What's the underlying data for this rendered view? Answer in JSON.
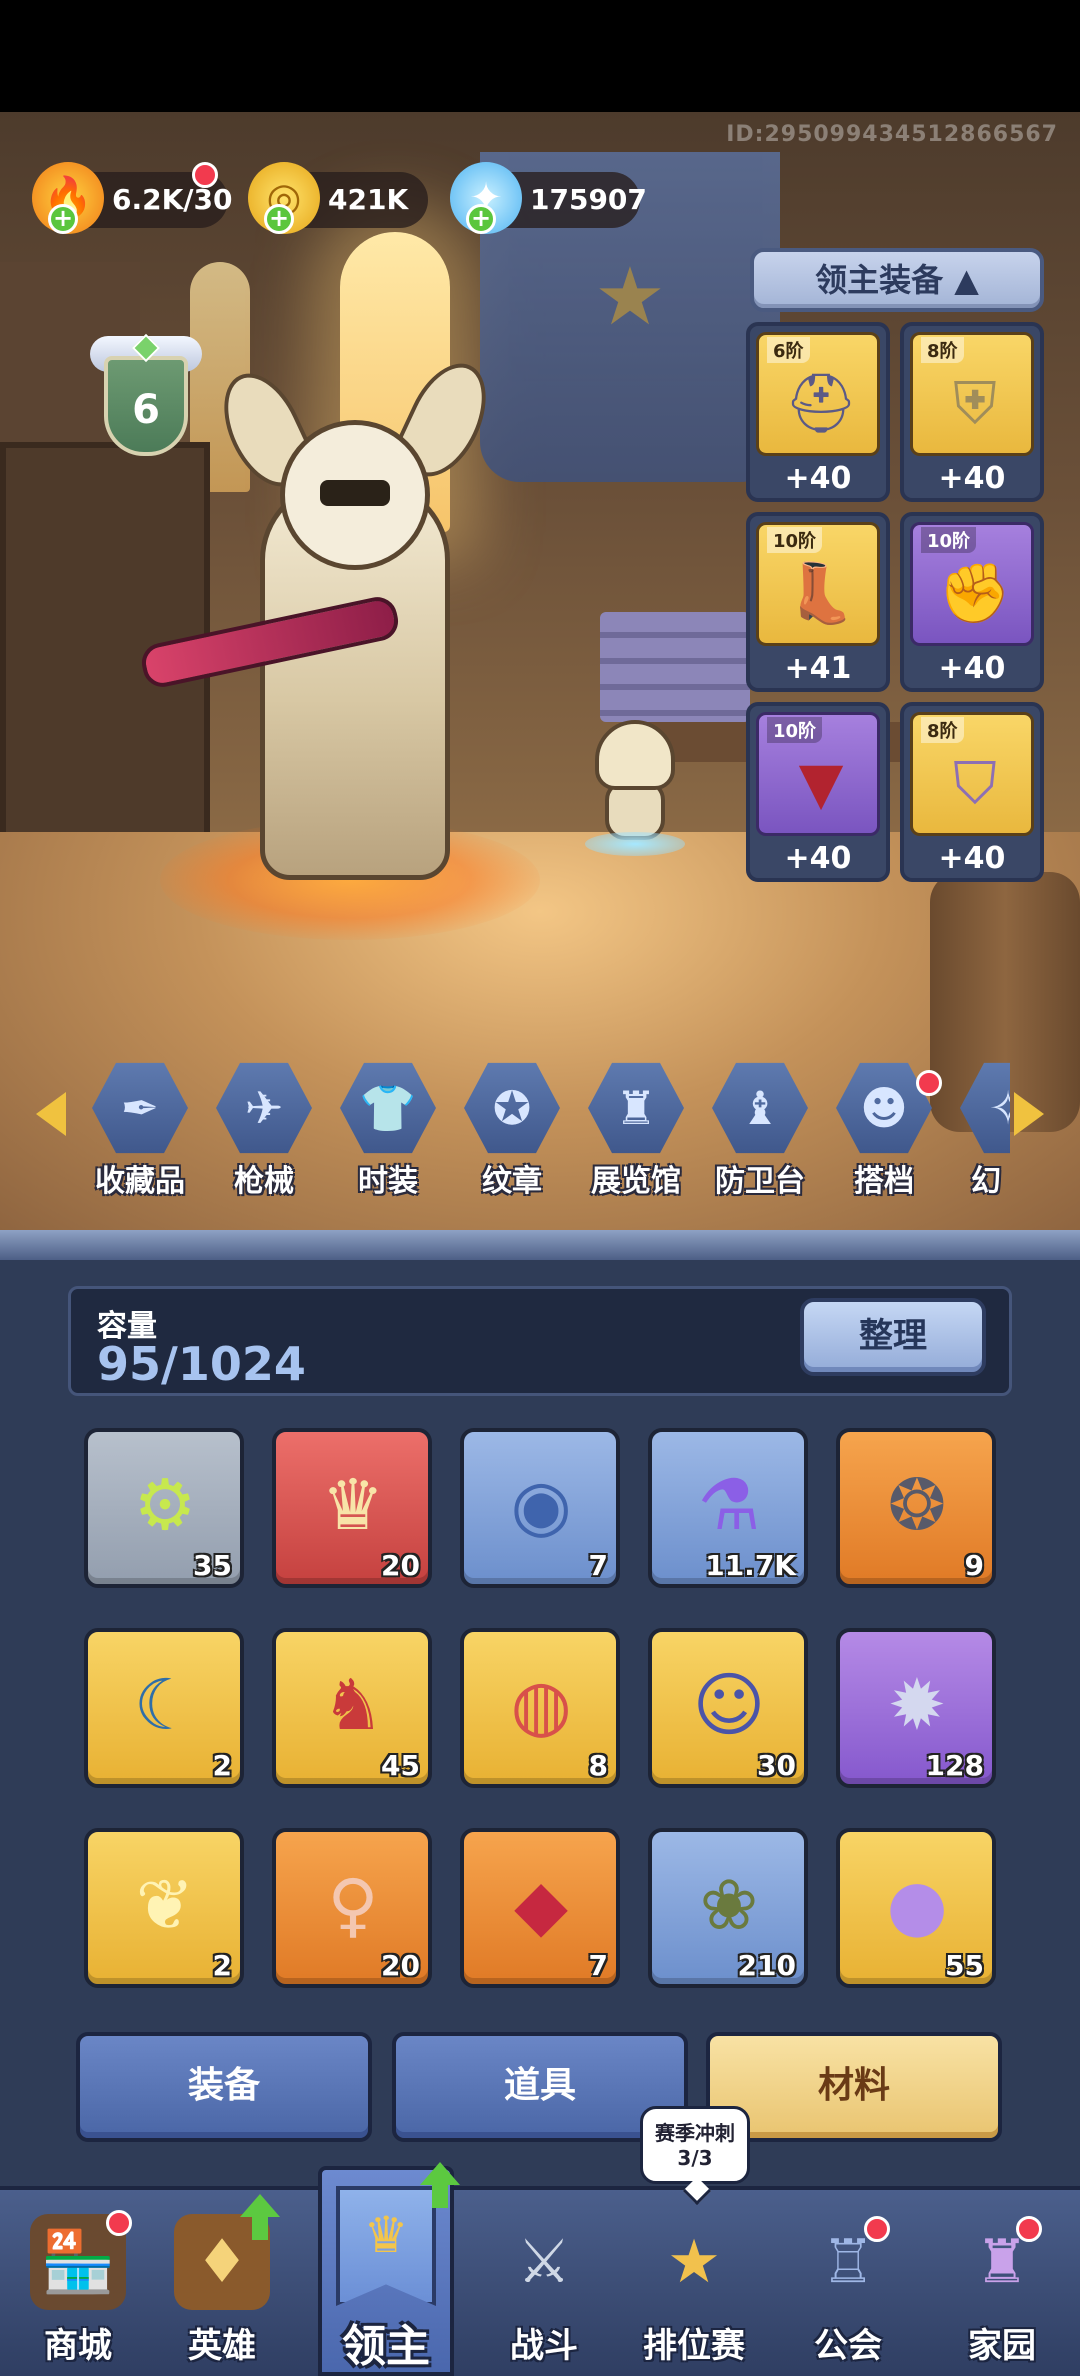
{
  "header": {
    "player_id": "ID:295099434512866567"
  },
  "resources": [
    {
      "name": "stamina",
      "icon": "fire-icon",
      "value": "6.2K/30"
    },
    {
      "name": "gold",
      "icon": "coin-icon",
      "value": "421K"
    },
    {
      "name": "crystal",
      "icon": "crystal-icon",
      "value": "175907"
    }
  ],
  "level": {
    "value": "6"
  },
  "equipment": {
    "title": "领主装备 ▲",
    "slots": [
      {
        "tier": "6阶",
        "bonus": "+40",
        "icon": "helmet-icon",
        "rarity": "gold"
      },
      {
        "tier": "8阶",
        "bonus": "+40",
        "icon": "armor-icon",
        "rarity": "gold"
      },
      {
        "tier": "10阶",
        "bonus": "+41",
        "icon": "boots-icon",
        "rarity": "gold"
      },
      {
        "tier": "10阶",
        "bonus": "+40",
        "icon": "gauntlet-icon",
        "rarity": "purple"
      },
      {
        "tier": "10阶",
        "bonus": "+40",
        "icon": "cape-icon",
        "rarity": "purple"
      },
      {
        "tier": "8阶",
        "bonus": "+40",
        "icon": "leg-armor-icon",
        "rarity": "gold"
      }
    ]
  },
  "categories": [
    {
      "label": "收藏品",
      "icon": "feather-icon"
    },
    {
      "label": "枪械",
      "icon": "gun-icon"
    },
    {
      "label": "时装",
      "icon": "outfit-icon"
    },
    {
      "label": "纹章",
      "icon": "emblem-icon"
    },
    {
      "label": "展览馆",
      "icon": "museum-icon"
    },
    {
      "label": "防卫台",
      "icon": "tower-icon"
    },
    {
      "label": "搭档",
      "icon": "partner-icon"
    },
    {
      "label": "幻",
      "icon": "illusion-icon"
    }
  ],
  "bag": {
    "capacity_label": "容量",
    "capacity_value": "95/1024",
    "sort_label": "整理",
    "items": [
      {
        "count": "35",
        "rarity": "gray",
        "icon": "blueprint-icon"
      },
      {
        "count": "20",
        "rarity": "red",
        "icon": "hero-shard-icon"
      },
      {
        "count": "7",
        "rarity": "blue",
        "icon": "blue-coin-icon"
      },
      {
        "count": "11.7K",
        "rarity": "blue",
        "icon": "potion-icon"
      },
      {
        "count": "9",
        "rarity": "orange",
        "icon": "gem-bracelet-icon"
      },
      {
        "count": "2",
        "rarity": "yellow",
        "icon": "moon-scroll-icon"
      },
      {
        "count": "45",
        "rarity": "yellow",
        "icon": "knight-shard-icon"
      },
      {
        "count": "8",
        "rarity": "yellow",
        "icon": "token-icon"
      },
      {
        "count": "30",
        "rarity": "yellow",
        "icon": "jester-shard-icon"
      },
      {
        "count": "128",
        "rarity": "purple",
        "icon": "moon-emblem-icon"
      },
      {
        "count": "2",
        "rarity": "yellow",
        "icon": "golden-pouch-icon"
      },
      {
        "count": "20",
        "rarity": "orange",
        "icon": "girl-shard-icon"
      },
      {
        "count": "7",
        "rarity": "orange",
        "icon": "ruby-orb-icon"
      },
      {
        "count": "210",
        "rarity": "blue",
        "icon": "fairy-shard-icon"
      },
      {
        "count": "55",
        "rarity": "yellow",
        "icon": "pearl-shell-icon"
      }
    ],
    "tabs": [
      {
        "label": "装备",
        "active": false
      },
      {
        "label": "道具",
        "active": false
      },
      {
        "label": "材料",
        "active": true
      }
    ],
    "event_tooltip": {
      "title": "赛季冲刺",
      "progress": "3/3"
    }
  },
  "nav": [
    {
      "label": "商城",
      "icon": "shop-icon"
    },
    {
      "label": "英雄",
      "icon": "hero-card-icon"
    },
    {
      "label": "领主",
      "icon": "lord-banner-icon",
      "active": true
    },
    {
      "label": "战斗",
      "icon": "battle-icon"
    },
    {
      "label": "排位赛",
      "icon": "ranked-icon"
    },
    {
      "label": "公会",
      "icon": "guild-icon"
    },
    {
      "label": "家园",
      "icon": "home-castle-icon"
    }
  ],
  "colors": {
    "bag_bg": "#2f3c57",
    "gold_tile": "#e9b83e",
    "purple_tile": "#8558cd",
    "active_tab": "#e9c470"
  }
}
